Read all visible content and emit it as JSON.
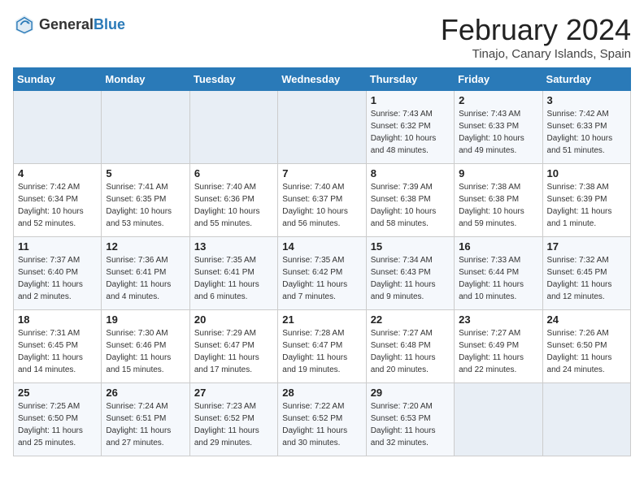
{
  "app": {
    "logo_general": "General",
    "logo_blue": "Blue"
  },
  "title": "February 2024",
  "subtitle": "Tinajo, Canary Islands, Spain",
  "headers": [
    "Sunday",
    "Monday",
    "Tuesday",
    "Wednesday",
    "Thursday",
    "Friday",
    "Saturday"
  ],
  "weeks": [
    [
      {
        "day": "",
        "info": ""
      },
      {
        "day": "",
        "info": ""
      },
      {
        "day": "",
        "info": ""
      },
      {
        "day": "",
        "info": ""
      },
      {
        "day": "1",
        "info": "Sunrise: 7:43 AM\nSunset: 6:32 PM\nDaylight: 10 hours\nand 48 minutes."
      },
      {
        "day": "2",
        "info": "Sunrise: 7:43 AM\nSunset: 6:33 PM\nDaylight: 10 hours\nand 49 minutes."
      },
      {
        "day": "3",
        "info": "Sunrise: 7:42 AM\nSunset: 6:33 PM\nDaylight: 10 hours\nand 51 minutes."
      }
    ],
    [
      {
        "day": "4",
        "info": "Sunrise: 7:42 AM\nSunset: 6:34 PM\nDaylight: 10 hours\nand 52 minutes."
      },
      {
        "day": "5",
        "info": "Sunrise: 7:41 AM\nSunset: 6:35 PM\nDaylight: 10 hours\nand 53 minutes."
      },
      {
        "day": "6",
        "info": "Sunrise: 7:40 AM\nSunset: 6:36 PM\nDaylight: 10 hours\nand 55 minutes."
      },
      {
        "day": "7",
        "info": "Sunrise: 7:40 AM\nSunset: 6:37 PM\nDaylight: 10 hours\nand 56 minutes."
      },
      {
        "day": "8",
        "info": "Sunrise: 7:39 AM\nSunset: 6:38 PM\nDaylight: 10 hours\nand 58 minutes."
      },
      {
        "day": "9",
        "info": "Sunrise: 7:38 AM\nSunset: 6:38 PM\nDaylight: 10 hours\nand 59 minutes."
      },
      {
        "day": "10",
        "info": "Sunrise: 7:38 AM\nSunset: 6:39 PM\nDaylight: 11 hours\nand 1 minute."
      }
    ],
    [
      {
        "day": "11",
        "info": "Sunrise: 7:37 AM\nSunset: 6:40 PM\nDaylight: 11 hours\nand 2 minutes."
      },
      {
        "day": "12",
        "info": "Sunrise: 7:36 AM\nSunset: 6:41 PM\nDaylight: 11 hours\nand 4 minutes."
      },
      {
        "day": "13",
        "info": "Sunrise: 7:35 AM\nSunset: 6:41 PM\nDaylight: 11 hours\nand 6 minutes."
      },
      {
        "day": "14",
        "info": "Sunrise: 7:35 AM\nSunset: 6:42 PM\nDaylight: 11 hours\nand 7 minutes."
      },
      {
        "day": "15",
        "info": "Sunrise: 7:34 AM\nSunset: 6:43 PM\nDaylight: 11 hours\nand 9 minutes."
      },
      {
        "day": "16",
        "info": "Sunrise: 7:33 AM\nSunset: 6:44 PM\nDaylight: 11 hours\nand 10 minutes."
      },
      {
        "day": "17",
        "info": "Sunrise: 7:32 AM\nSunset: 6:45 PM\nDaylight: 11 hours\nand 12 minutes."
      }
    ],
    [
      {
        "day": "18",
        "info": "Sunrise: 7:31 AM\nSunset: 6:45 PM\nDaylight: 11 hours\nand 14 minutes."
      },
      {
        "day": "19",
        "info": "Sunrise: 7:30 AM\nSunset: 6:46 PM\nDaylight: 11 hours\nand 15 minutes."
      },
      {
        "day": "20",
        "info": "Sunrise: 7:29 AM\nSunset: 6:47 PM\nDaylight: 11 hours\nand 17 minutes."
      },
      {
        "day": "21",
        "info": "Sunrise: 7:28 AM\nSunset: 6:47 PM\nDaylight: 11 hours\nand 19 minutes."
      },
      {
        "day": "22",
        "info": "Sunrise: 7:27 AM\nSunset: 6:48 PM\nDaylight: 11 hours\nand 20 minutes."
      },
      {
        "day": "23",
        "info": "Sunrise: 7:27 AM\nSunset: 6:49 PM\nDaylight: 11 hours\nand 22 minutes."
      },
      {
        "day": "24",
        "info": "Sunrise: 7:26 AM\nSunset: 6:50 PM\nDaylight: 11 hours\nand 24 minutes."
      }
    ],
    [
      {
        "day": "25",
        "info": "Sunrise: 7:25 AM\nSunset: 6:50 PM\nDaylight: 11 hours\nand 25 minutes."
      },
      {
        "day": "26",
        "info": "Sunrise: 7:24 AM\nSunset: 6:51 PM\nDaylight: 11 hours\nand 27 minutes."
      },
      {
        "day": "27",
        "info": "Sunrise: 7:23 AM\nSunset: 6:52 PM\nDaylight: 11 hours\nand 29 minutes."
      },
      {
        "day": "28",
        "info": "Sunrise: 7:22 AM\nSunset: 6:52 PM\nDaylight: 11 hours\nand 30 minutes."
      },
      {
        "day": "29",
        "info": "Sunrise: 7:20 AM\nSunset: 6:53 PM\nDaylight: 11 hours\nand 32 minutes."
      },
      {
        "day": "",
        "info": ""
      },
      {
        "day": "",
        "info": ""
      }
    ]
  ]
}
